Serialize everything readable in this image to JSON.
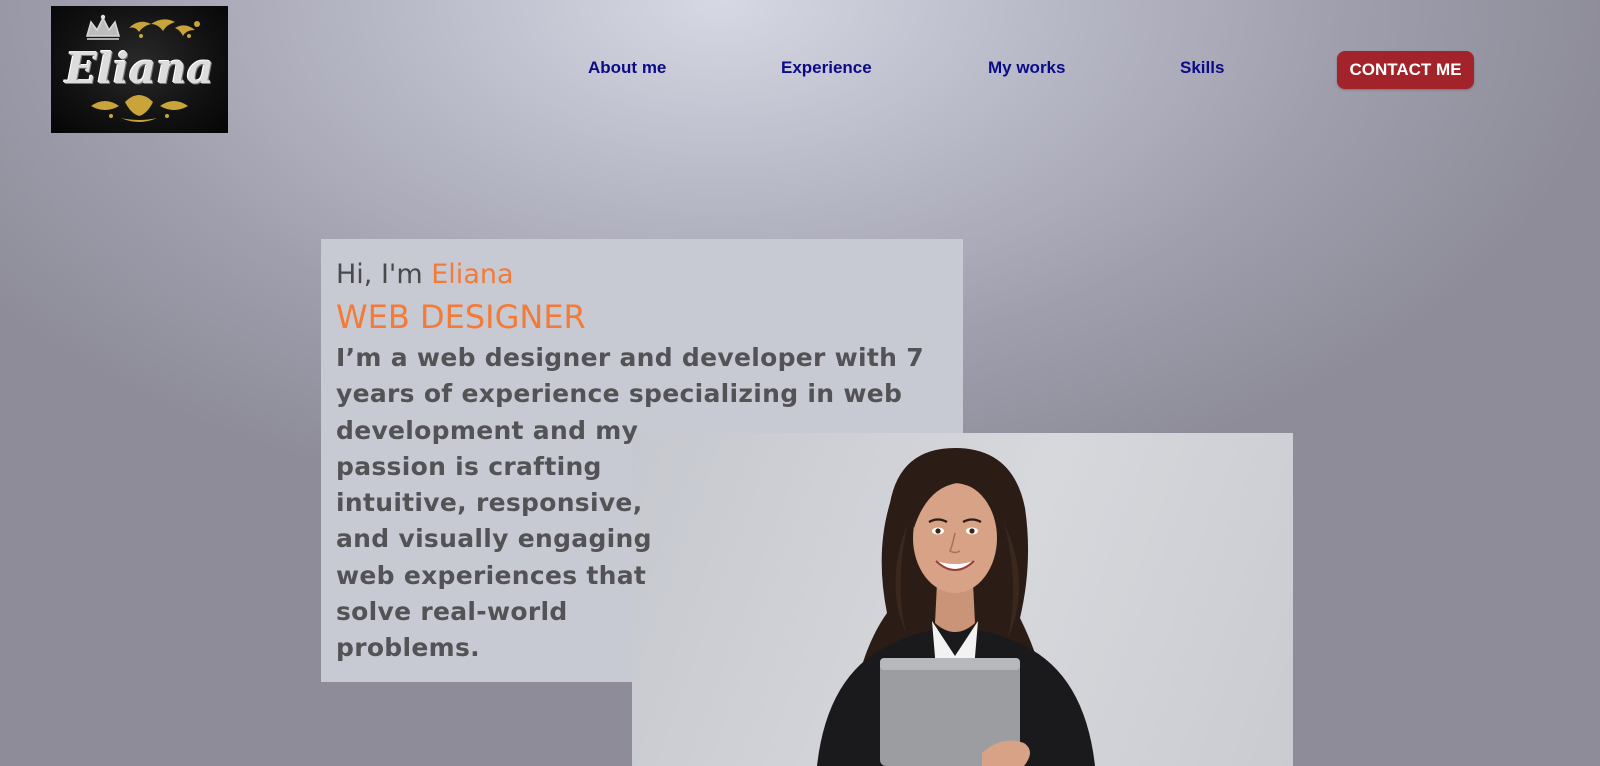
{
  "logo": {
    "text": "Eliana",
    "icon": "crown-ornament-logo"
  },
  "nav": {
    "items": [
      {
        "label": "About me"
      },
      {
        "label": "Experience"
      },
      {
        "label": "My works"
      },
      {
        "label": "Skills"
      }
    ],
    "contact_label": "CONTACT ME"
  },
  "hero": {
    "greeting_prefix": "Hi, I'm ",
    "name": "Eliana",
    "role": "WEB DESIGNER",
    "bio_lines": [
      "I’m a web designer and developer with 7",
      "years of experience specializing in web",
      "development and my",
      "passion is crafting",
      "intuitive, responsive,",
      "and visually engaging",
      "web experiences that",
      "solve real-world",
      "problems."
    ]
  },
  "photo": {
    "icon": "woman-holding-laptop-photo"
  },
  "colors": {
    "accent": "#f47a38",
    "nav_text": "#0b0b8a",
    "contact_bg": "#a3232a",
    "card_bg": "#c8cad3"
  }
}
